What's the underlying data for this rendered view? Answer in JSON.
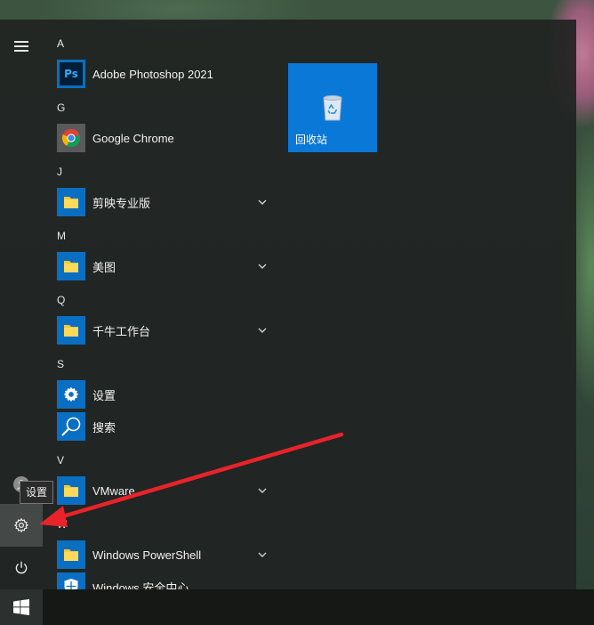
{
  "rail": {
    "tooltip": "设置"
  },
  "app_list": {
    "sections": [
      {
        "letter": "A",
        "apps": [
          {
            "label": "Adobe Photoshop 2021",
            "icon": "photoshop-icon",
            "expandable": false
          }
        ]
      },
      {
        "letter": "G",
        "apps": [
          {
            "label": "Google Chrome",
            "icon": "chrome-icon",
            "expandable": false
          }
        ]
      },
      {
        "letter": "J",
        "apps": [
          {
            "label": "剪映专业版",
            "icon": "folder-icon",
            "expandable": true
          }
        ]
      },
      {
        "letter": "M",
        "apps": [
          {
            "label": "美图",
            "icon": "folder-icon",
            "expandable": true
          }
        ]
      },
      {
        "letter": "Q",
        "apps": [
          {
            "label": "千牛工作台",
            "icon": "folder-icon",
            "expandable": true
          }
        ]
      },
      {
        "letter": "S",
        "apps": [
          {
            "label": "设置",
            "icon": "gear-icon",
            "expandable": false
          },
          {
            "label": "搜索",
            "icon": "search-icon",
            "expandable": false
          }
        ]
      },
      {
        "letter": "V",
        "apps": [
          {
            "label": "VMware",
            "icon": "folder-icon",
            "expandable": true
          }
        ]
      },
      {
        "letter": "W",
        "apps": [
          {
            "label": "Windows PowerShell",
            "icon": "folder-icon",
            "expandable": true
          },
          {
            "label": "Windows 安全中心",
            "icon": "shield-icon",
            "expandable": false
          }
        ]
      }
    ]
  },
  "tiles": [
    {
      "label": "回收站",
      "icon": "recycle-bin-icon"
    }
  ],
  "colors": {
    "accent": "#0a78d7",
    "annotation_arrow": "#e8232a"
  }
}
